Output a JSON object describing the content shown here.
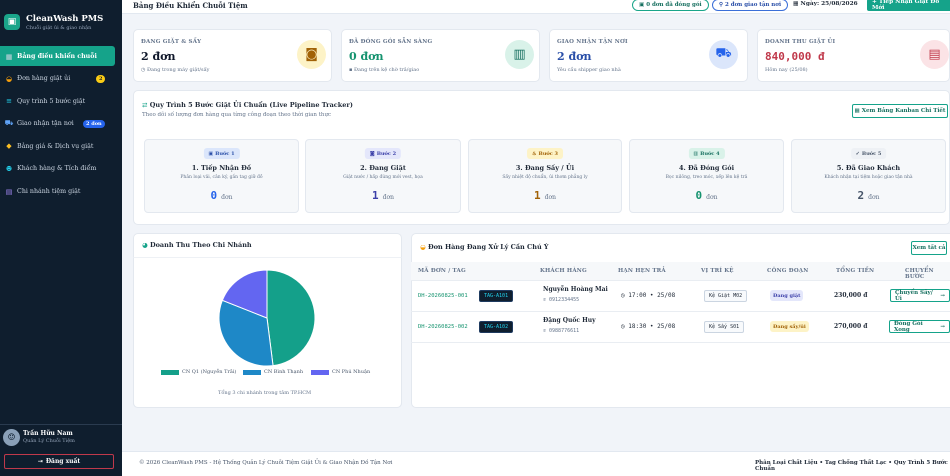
{
  "brand": {
    "name": "CleanWash PMS",
    "subtitle": "Chuỗi giặt ủi & giao nhận"
  },
  "sidebar": {
    "items": [
      {
        "label": "Bảng điều khiển chuỗi",
        "icon": "dashboard-icon",
        "active": true
      },
      {
        "label": "Đơn hàng giặt ủi",
        "icon": "basket-icon",
        "badge": "2"
      },
      {
        "label": "Quy trình 5 bước giặt",
        "icon": "steps-icon"
      },
      {
        "label": "Giao nhận tận nơi",
        "icon": "truck-icon",
        "badge": "2 đơn"
      },
      {
        "label": "Bảng giá & Dịch vụ giặt",
        "icon": "tag-icon"
      },
      {
        "label": "Khách hàng & Tích điểm",
        "icon": "users-icon"
      },
      {
        "label": "Chi nhánh tiệm giặt",
        "icon": "store-icon"
      }
    ]
  },
  "user": {
    "name": "Trần Hữu Nam",
    "role": "Quản Lý Chuỗi Tiệm",
    "logout": "Đăng xuất"
  },
  "header": {
    "title": "Bảng Điều Khiển Chuỗi Tiệm",
    "pill_packed": "0 đơn đã đóng gói",
    "pill_delivery": "2 đơn giao tận nơi",
    "date": "Ngày: 25/08/2026",
    "new_order": "+ Tiếp Nhận Giặt Đồ Mới"
  },
  "stats": [
    {
      "label": "ĐANG GIẶT & SẤY",
      "value": "2 đơn",
      "sub": "Đang trong máy giặt/sấy",
      "color": "#0f172a",
      "icon": "washing-machine-icon",
      "icon_bg": "#fdf3c7",
      "icon_color": "#a16207"
    },
    {
      "label": "ĐÃ ĐÓNG GÓI SẴN SÀNG",
      "value": "0 đơn",
      "sub": "Đang trên kệ chờ trả/giao",
      "color": "#15936f",
      "icon": "package-icon",
      "icon_bg": "#d9f2e9",
      "icon_color": "#166f5f"
    },
    {
      "label": "GIAO NHẬN TẬN NƠI",
      "value": "2 đơn",
      "sub": "Yêu cầu shipper giao nhà",
      "color": "#2a4fa8",
      "icon": "truck-icon",
      "icon_bg": "#dbe6fb",
      "icon_color": "#2563eb"
    },
    {
      "label": "DOANH THU GIẶT ỦI",
      "value": "840,000 đ",
      "sub": "Hôm nay (25/08)",
      "color": "#c0394b",
      "icon": "receipt-icon",
      "icon_bg": "#fbe3e6",
      "icon_color": "#c0394b"
    }
  ],
  "pipeline": {
    "title": "Quy Trình 5 Bước Giặt Ủi Chuẩn (Live Pipeline Tracker)",
    "subtitle": "Theo dõi số lượng đơn hàng qua từng công đoạn theo thời gian thực",
    "kanban_button": "Xem Bảng Kanban Chi Tiết",
    "unit": "đơn",
    "steps": [
      {
        "badge": "Bước 1",
        "title": "1. Tiếp Nhận Đồ",
        "desc": "Phân loại vải, cân ký, gắn tag giữ đồ",
        "count": "0",
        "badge_bg": "#dbe6fb",
        "badge_color": "#2a4fa8",
        "count_color": "#2563eb"
      },
      {
        "badge": "Bước 2",
        "title": "2. Đang Giặt",
        "desc": "Giặt nước / hấp đúng mới vest, họa",
        "count": "1",
        "badge_bg": "#e4e7fb",
        "badge_color": "#3b3fa8",
        "count_color": "#3b3fa8"
      },
      {
        "badge": "Bước 3",
        "title": "3. Đang Sấy / Ủi",
        "desc": "Sấy nhiệt độ chuẩn, ủi thơm phẳng ly",
        "count": "1",
        "badge_bg": "#fdf3c7",
        "badge_color": "#a16207",
        "count_color": "#a16207"
      },
      {
        "badge": "Bước 4",
        "title": "4. Đã Đóng Gói",
        "desc": "Bọc nilông, treo móc, xếp lên kệ trả",
        "count": "0",
        "badge_bg": "#d9f2e9",
        "badge_color": "#166f5f",
        "count_color": "#15936f"
      },
      {
        "badge": "Bước 5",
        "title": "5. Đã Giao Khách",
        "desc": "Khách nhận tại tiệm hoặc giao tận nhà",
        "count": "2",
        "badge_bg": "#eef1f5",
        "badge_color": "#475569",
        "count_color": "#475569"
      }
    ]
  },
  "revenue": {
    "title": "Doanh Thu Theo Chi Nhánh",
    "note": "Tổng 3 chi nhánh trong tâm TP.HCM"
  },
  "chart_data": {
    "type": "pie",
    "labels": [
      "CN Q1 (Nguyễn Trãi)",
      "CN Bình Thạnh",
      "CN Phú Nhuận"
    ],
    "values": [
      48,
      33,
      19
    ],
    "colors": [
      "#14a08a",
      "#1e88c7",
      "#6366f1"
    ]
  },
  "orders": {
    "title": "Đơn Hàng Đang Xử Lý Cần Chú Ý",
    "view_all": "Xem tất cả",
    "columns": [
      "MÃ ĐƠN / TAG",
      "KHÁCH HÀNG",
      "HẠN HẸN TRẢ",
      "VỊ TRÍ KỆ",
      "CÔNG ĐOẠN",
      "TỔNG TIỀN",
      "CHUYỂN BƯỚC"
    ],
    "rows": [
      {
        "code": "DH-20260825-001",
        "tag": "TAG-A101",
        "customer": "Nguyễn Hoàng Mai",
        "phone": "0912334455",
        "deadline": "17:00 • 25/08",
        "shelf": "Kệ Giặt M02",
        "stage": "Đang giặt",
        "stage_bg": "#e4e7fb",
        "stage_color": "#3b3fa8",
        "total": "230,000 đ",
        "action": "Chuyển Sấy/Ủi"
      },
      {
        "code": "DH-20260825-002",
        "tag": "TAG-A102",
        "customer": "Đặng Quốc Huy",
        "phone": "0988776611",
        "deadline": "18:30 • 25/08",
        "shelf": "Kệ Sấy S01",
        "stage": "Đang sấy/ủi",
        "stage_bg": "#fdf3c7",
        "stage_color": "#a16207",
        "total": "270,000 đ",
        "action": "Đóng Gói Xong"
      }
    ]
  },
  "footer": {
    "left": "© 2026 CleanWash PMS - Hệ Thống Quản Lý Chuỗi Tiệm Giặt Ủi & Giao Nhận Đồ Tận Nơi",
    "right": "Phân Loại Chất Liệu • Tag Chống Thất Lạc • Quy Trình 5 Bước Chuẩn"
  }
}
